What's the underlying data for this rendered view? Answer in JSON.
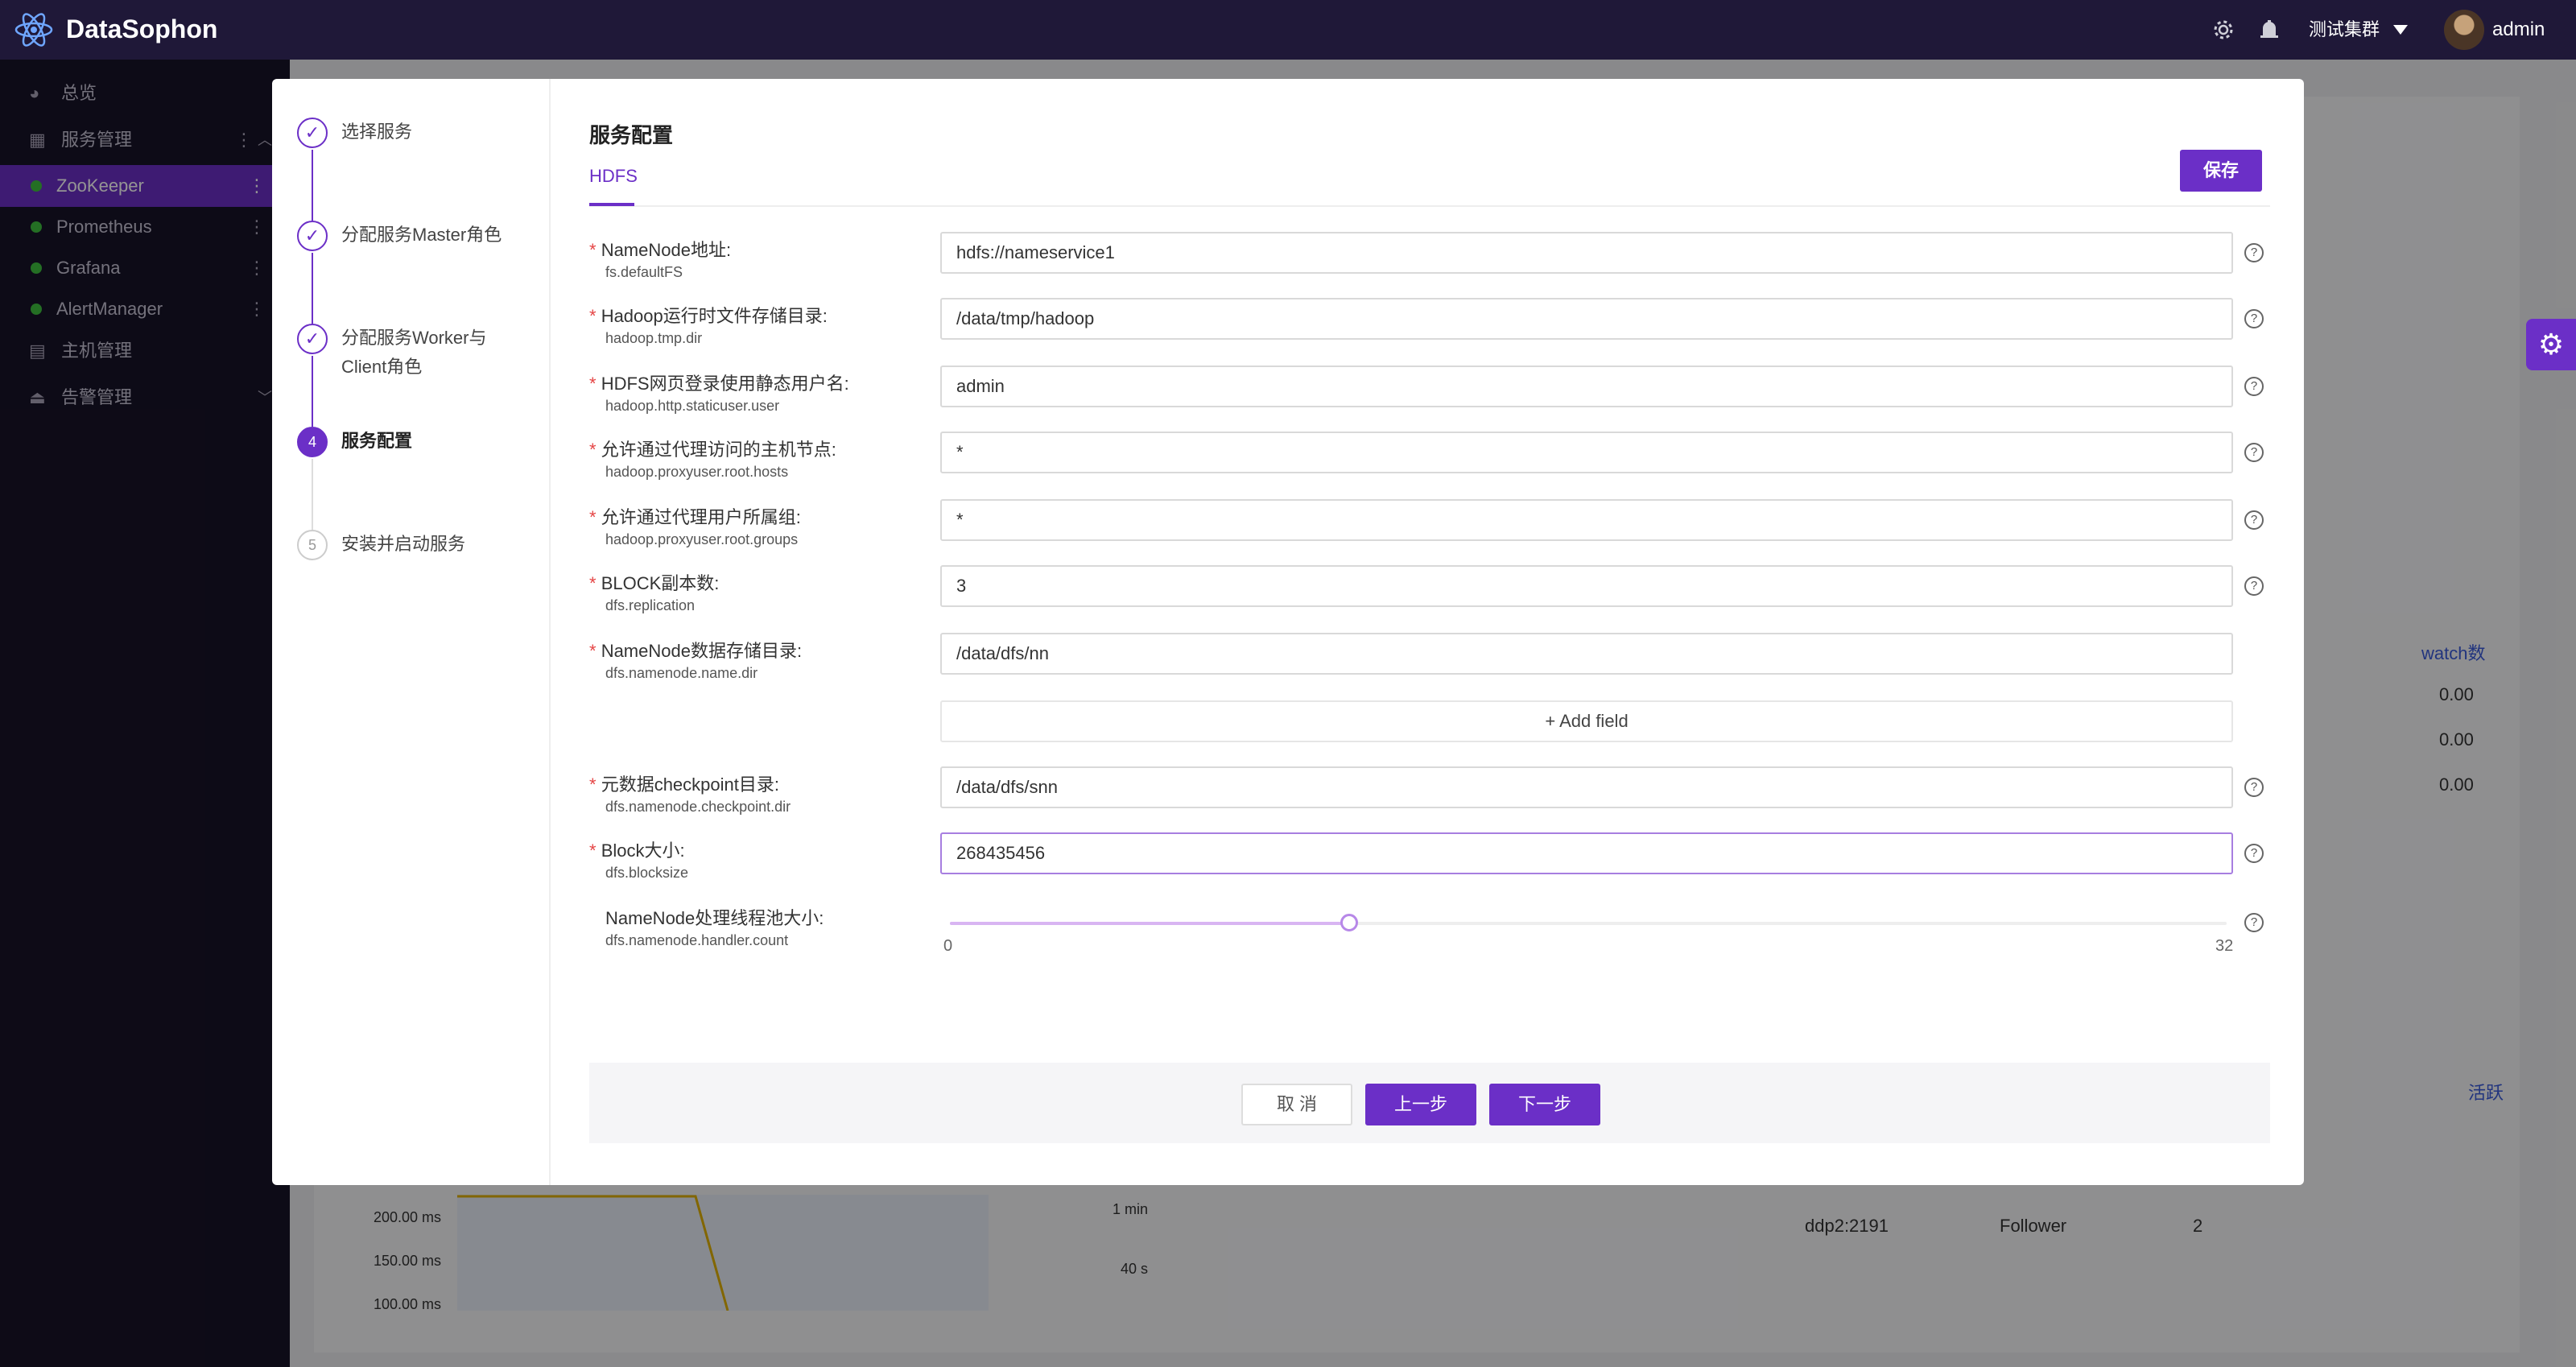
{
  "topbar": {
    "app_name": "DataSophon",
    "cluster_name": "测试集群",
    "user_name": "admin",
    "icons": [
      "gear-icon",
      "bell-icon",
      "caret-down-icon"
    ]
  },
  "sidebar": {
    "items": [
      {
        "label": "总览",
        "icon": "dashboard-icon"
      },
      {
        "label": "服务管理",
        "icon": "grid-icon"
      },
      {
        "label": "ZooKeeper",
        "status": "running"
      },
      {
        "label": "Prometheus",
        "status": "running"
      },
      {
        "label": "Grafana",
        "status": "running"
      },
      {
        "label": "AlertManager",
        "status": "running"
      },
      {
        "label": "主机管理",
        "icon": "server-icon"
      },
      {
        "label": "告警管理",
        "icon": "alarm-icon"
      }
    ]
  },
  "background": {
    "col_watch": "watch数",
    "watch_values": [
      "0.00",
      "0.00",
      "0.00"
    ],
    "col_active": "活跃",
    "chart1_ticks": [
      "200.00 ms",
      "150.00 ms",
      "100.00 ms"
    ],
    "chart2_ticks": [
      "1 min",
      "40 s"
    ],
    "row": {
      "host": "ddp2:2191",
      "role": "Follower",
      "num": "2"
    }
  },
  "steps": [
    {
      "index": "1",
      "title": "选择服务",
      "state": "done"
    },
    {
      "index": "2",
      "title": "分配服务Master角色",
      "state": "done"
    },
    {
      "index": "3",
      "title": "分配服务Worker与Client角色",
      "state": "done"
    },
    {
      "index": "4",
      "title": "服务配置",
      "state": "current"
    },
    {
      "index": "5",
      "title": "安装并启动服务",
      "state": "todo"
    }
  ],
  "main": {
    "section_title": "服务配置",
    "tab": "HDFS",
    "save_label": "保存",
    "fields": [
      {
        "label": "NameNode地址:",
        "key": "fs.defaultFS",
        "value": "hdfs://nameservice1",
        "required": true
      },
      {
        "label": "Hadoop运行时文件存储目录:",
        "key": "hadoop.tmp.dir",
        "value": "/data/tmp/hadoop",
        "required": true
      },
      {
        "label": "HDFS网页登录使用静态用户名:",
        "key": "hadoop.http.staticuser.user",
        "value": "admin",
        "required": true
      },
      {
        "label": "允许通过代理访问的主机节点:",
        "key": "hadoop.proxyuser.root.hosts",
        "value": "*",
        "required": true
      },
      {
        "label": "允许通过代理用户所属组:",
        "key": "hadoop.proxyuser.root.groups",
        "value": "*",
        "required": true
      },
      {
        "label": "BLOCK副本数:",
        "key": "dfs.replication",
        "value": "3",
        "required": true
      },
      {
        "label": "NameNode数据存储目录:",
        "key": "dfs.namenode.name.dir",
        "value": "/data/dfs/nn",
        "required": true
      },
      {
        "label": "元数据checkpoint目录:",
        "key": "dfs.namenode.checkpoint.dir",
        "value": "/data/dfs/snn",
        "required": true
      },
      {
        "label": "Block大小:",
        "key": "dfs.blocksize",
        "value": "268435456",
        "required": true
      }
    ],
    "add_field_label": "Add field",
    "slider": {
      "label": "NameNode处理线程池大小:",
      "key": "dfs.namenode.handler.count",
      "min": "0",
      "max": "32",
      "value": 10
    },
    "cancel_label": "取 消",
    "prev_label": "上一步",
    "next_label": "下一步"
  },
  "colors": {
    "accent": "#6b2fc7",
    "topbar": "#1f1838",
    "sidebar": "#181328",
    "required": "#e54545"
  }
}
